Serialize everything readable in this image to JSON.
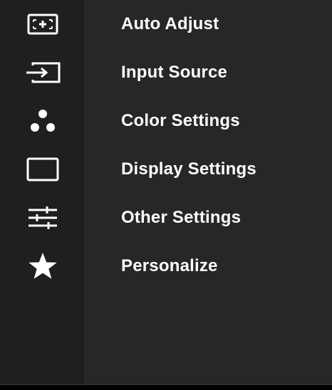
{
  "menu": {
    "items": [
      {
        "label": "Auto Adjust",
        "icon": "auto-adjust-icon"
      },
      {
        "label": "Input Source",
        "icon": "input-source-icon"
      },
      {
        "label": "Color Settings",
        "icon": "color-settings-icon"
      },
      {
        "label": "Display Settings",
        "icon": "display-settings-icon"
      },
      {
        "label": "Other Settings",
        "icon": "other-settings-icon"
      },
      {
        "label": "Personalize",
        "icon": "star-icon"
      }
    ]
  },
  "colors": {
    "panel_background": "#272727",
    "icon_column": "#1f1f1f",
    "text": "#ffffff"
  }
}
